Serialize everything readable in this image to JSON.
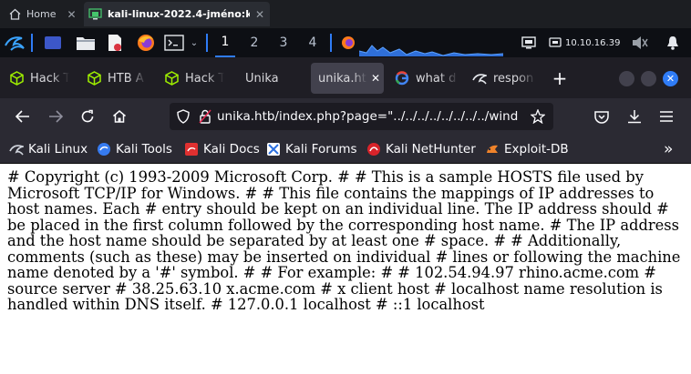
{
  "host_tabs": [
    {
      "label": "Home",
      "icon": "home-icon"
    },
    {
      "label": "kali-linux-2022.4-jméno:k…",
      "icon": "vm-icon"
    }
  ],
  "panel": {
    "workspaces": [
      "1",
      "2",
      "3",
      "4"
    ],
    "ip": "10.10.16.39",
    "accent": "#2f7cf6"
  },
  "firefox_tabs": [
    {
      "label": "Hack T",
      "icon": "hackthebox-icon"
    },
    {
      "label": "HTB A",
      "icon": "hackthebox-icon"
    },
    {
      "label": "Hack T",
      "icon": "hackthebox-icon"
    },
    {
      "label": "Unika",
      "icon": ""
    },
    {
      "label": "unika.ht",
      "icon": "",
      "active": true
    },
    {
      "label": "what d",
      "icon": "google-icon"
    },
    {
      "label": "respon",
      "icon": "kali-dragon-icon"
    }
  ],
  "navbar": {
    "url": "unika.htb/index.php?page=\"../../../../../../../../wind"
  },
  "bookmarks": [
    {
      "label": "Kali Linux",
      "icon": "kali-linux-icon"
    },
    {
      "label": "Kali Tools",
      "icon": "kali-tools-icon"
    },
    {
      "label": "Kali Docs",
      "icon": "kali-docs-icon"
    },
    {
      "label": "Kali Forums",
      "icon": "kali-forums-icon"
    },
    {
      "label": "Kali NetHunter",
      "icon": "nethunter-icon"
    },
    {
      "label": "Exploit-DB",
      "icon": "exploit-db-icon"
    }
  ],
  "page": {
    "text": "# Copyright (c) 1993-2009 Microsoft Corp. # # This is a sample HOSTS file used by Microsoft TCP/IP for Windows. # # This file contains the mappings of IP addresses to host names. Each # entry should be kept on an individual line. The IP address should # be placed in the first column followed by the corresponding host name. # The IP address and the host name should be separated by at least one # space. # # Additionally, comments (such as these) may be inserted on individual # lines or following the machine name denoted by a '#' symbol. # # For example: # # 102.54.94.97 rhino.acme.com # source server # 38.25.63.10 x.acme.com # x client host # localhost name resolution is handled within DNS itself. # 127.0.0.1 localhost # ::1 localhost"
  }
}
